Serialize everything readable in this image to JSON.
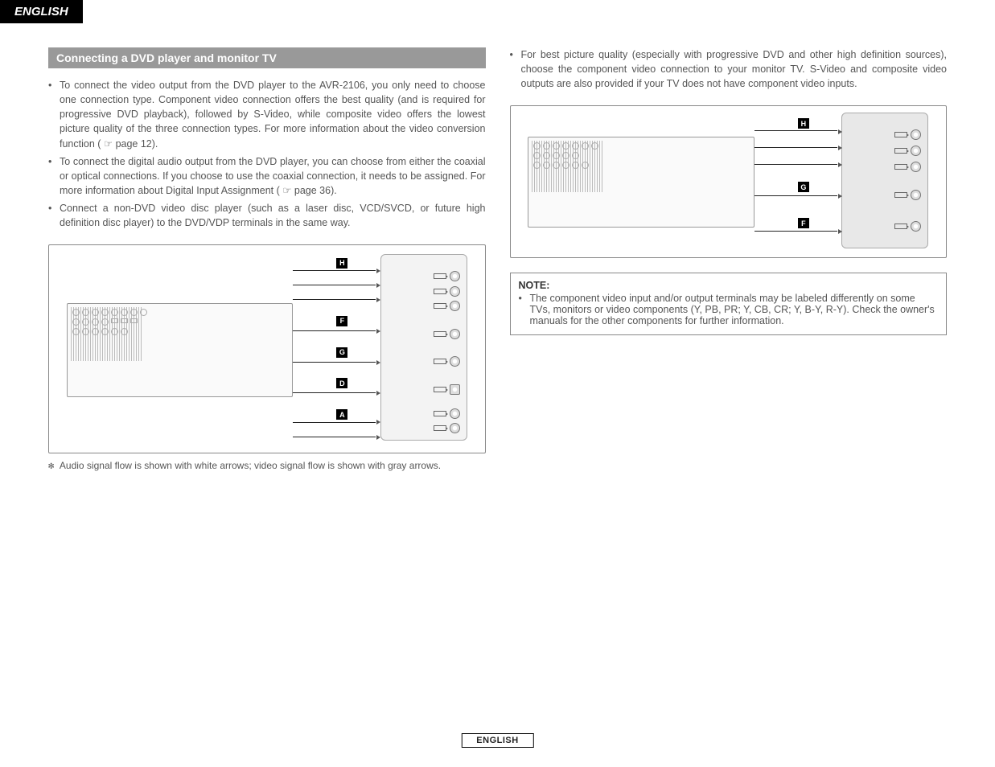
{
  "header": {
    "lang": "ENGLISH"
  },
  "footer": {
    "lang": "ENGLISH"
  },
  "left": {
    "section_title": "Connecting a DVD player and monitor TV",
    "bullets": [
      "To connect the video output from the DVD player to the AVR-2106, you only need to choose one connection type. Component video connection offers the best quality (and is required for progressive DVD playback), followed by S-Video, while composite video offers the lowest picture quality of the three connection types. For more information about the video conversion function ( ☞ page 12).",
      "To connect the digital audio output from the DVD player, you can choose from either the coaxial or optical connections. If you choose to use the coaxial connection, it needs to be assigned. For more information about Digital Input Assignment ( ☞ page 36).",
      "Connect a non-DVD video disc player (such as a laser disc, VCD/SVCD, or future high definition disc player) to the DVD/VDP terminals in the same way."
    ],
    "labels": [
      "H",
      "F",
      "G",
      "D",
      "A"
    ],
    "caption_prefix": "✻",
    "caption": "Audio signal flow is shown with white arrows; video signal flow is shown with gray arrows."
  },
  "right": {
    "bullets": [
      "For best picture quality (especially with progressive DVD and other high definition sources), choose the component video connection to your monitor TV. S-Video and composite video outputs are also provided if your TV does not have component video inputs."
    ],
    "labels": [
      "H",
      "G",
      "F"
    ],
    "note_title": "NOTE:",
    "note_text": "The component video input and/or output terminals may be labeled differently on some TVs, monitors or video components (Y, PB, PR; Y, CB, CR; Y, B-Y, R-Y). Check the owner's manuals for the other components for further information."
  }
}
